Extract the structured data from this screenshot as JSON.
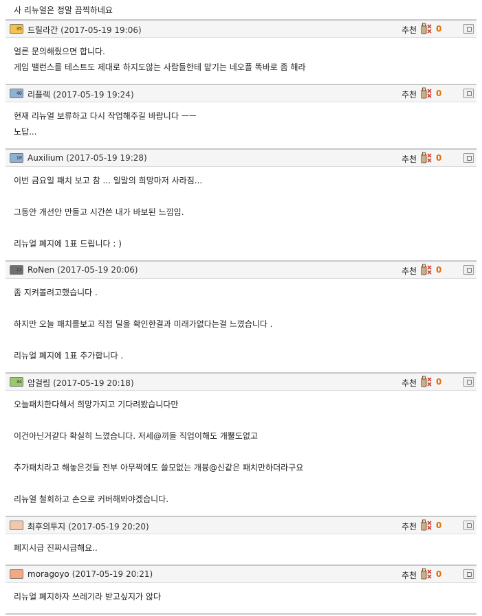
{
  "top_text": "사 리뉴얼은 정말 끔찍하네요",
  "recommend_label": "추천",
  "colors": {
    "count": "#e0700a",
    "header_bg": "#f5f5f5",
    "rule": "#c8c8c8"
  },
  "comments": [
    {
      "level": "35",
      "level_color": "#f3c24a",
      "nick": "드릴라간",
      "date": "(2017-05-19 19:06)",
      "count": "0",
      "lines": [
        "얼른 문의해줬으면 합니다.",
        "게임 밸런스를 테스트도 제대로 하지도않는 사람들한테 맡기는 네오플 똑바로 좀 해라"
      ]
    },
    {
      "level": "40",
      "level_color": "#8fb0d9",
      "nick": "리플렉",
      "date": "(2017-05-19 19:24)",
      "count": "0",
      "lines": [
        "현재 리뉴얼 보류하고 다시 작업해주길 바랍니다 ㅡㅡ",
        "노답..."
      ]
    },
    {
      "level": "10",
      "level_color": "#8fb0d9",
      "nick": "Auxilium",
      "date": "(2017-05-19 19:28)",
      "count": "0",
      "lines": [
        "이번 금요일 패치 보고 참 ... 일말의 희망마저 사라짐...",
        "",
        "그동안 개선안 만들고 시간쓴 내가 바보된 느낌임.",
        "",
        "리뉴얼 폐지에 1표 드립니다 : )"
      ]
    },
    {
      "level": "11",
      "level_color": "#6f6f6f",
      "nick": "RoNen",
      "date": "(2017-05-19 20:06)",
      "count": "0",
      "lines": [
        "좀 지켜볼려고했습니다 .",
        "",
        "하지만 오늘 패치를보고 직접 딜을 확인한결과 미래가없다는걸 느꼈습니다 .",
        "",
        "리뉴얼 폐지에 1표 추가합니다 ."
      ]
    },
    {
      "level": "34",
      "level_color": "#9bc86a",
      "nick": "암걸림",
      "date": "(2017-05-19 20:18)",
      "count": "0",
      "lines": [
        "오늘패치한다해서 희망가지고 기다려봤습니다만",
        "",
        "이건아닌거같다 확실히 느꼈습니다. 저세@끼들 직업이해도 개뿔도없고",
        "",
        "추가패치라고 해놓은것들 전부 아무짝에도 쓸모없는 개븅@신같은 패치만하더라구요",
        "",
        "리뉴얼 철회하고 손으로 커버해봐야겠습니다."
      ]
    },
    {
      "level": "",
      "level_color": "#f4c7a8",
      "nick": "최후의투지",
      "date": "(2017-05-19 20:20)",
      "count": "0",
      "lines": [
        "폐지시급 진짜시급해요.."
      ]
    },
    {
      "level": "",
      "level_color": "#f0a982",
      "nick": "moragoyo",
      "date": "(2017-05-19 20:21)",
      "count": "0",
      "lines": [
        "리뉴얼 폐지하자 쓰레기라 받고싶지가 않다"
      ]
    }
  ]
}
